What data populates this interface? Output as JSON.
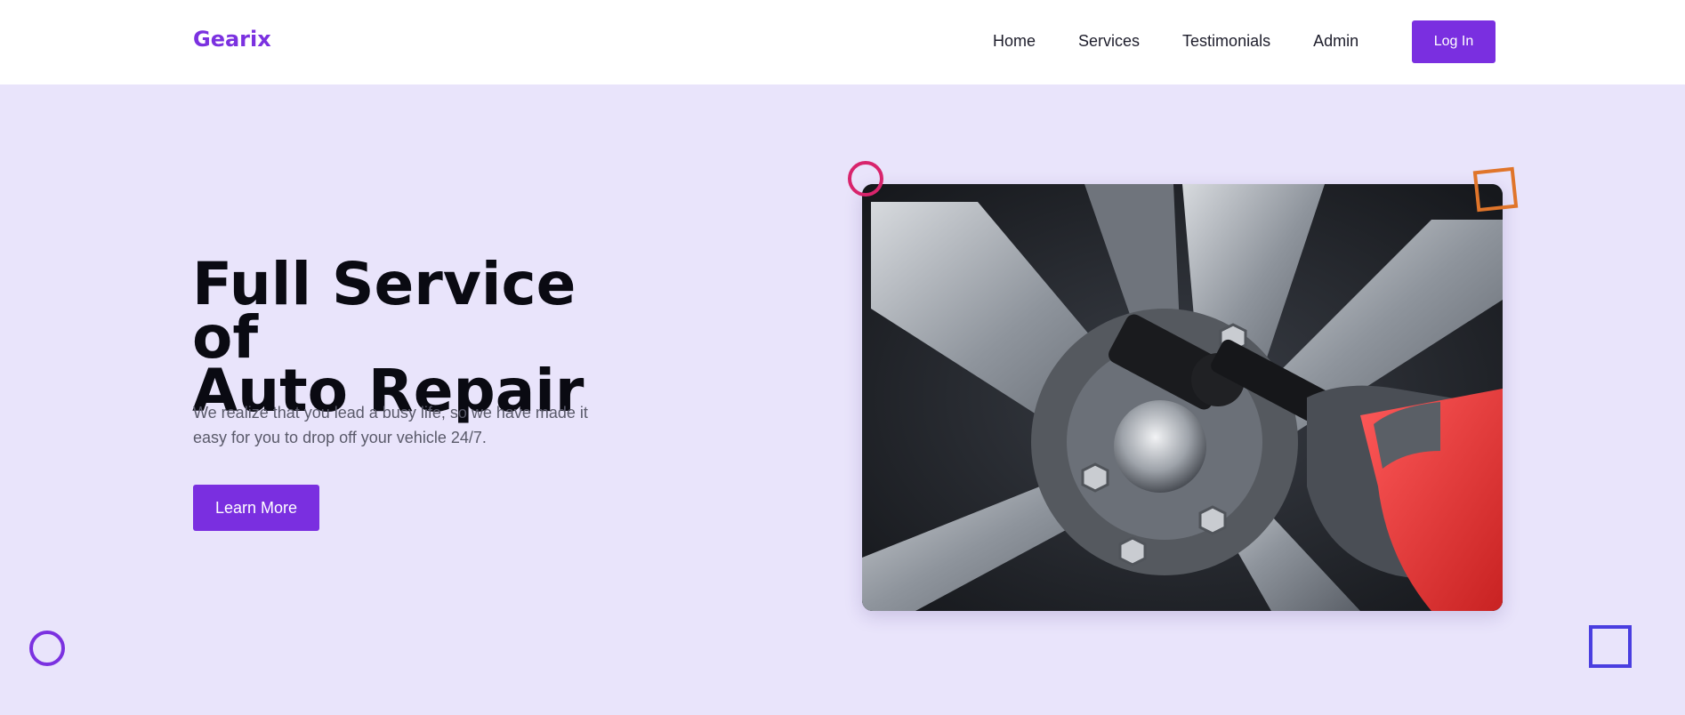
{
  "brand": {
    "name": "Gearix"
  },
  "nav": {
    "links": [
      "Home",
      "Services",
      "Testimonials",
      "Admin"
    ],
    "login_label": "Log In"
  },
  "hero": {
    "title_line1": "Full Service of",
    "title_line2": "Auto Repair",
    "description": "We realize that you lead a busy life, so we have made it easy for you to drop off your vehicle 24/7.",
    "cta_label": "Learn More",
    "image_subject": "impact-wrench-on-car-wheel"
  },
  "colors": {
    "accent": "#7b31e0",
    "background": "#e9e4fb",
    "deco_pink": "#d8246c",
    "deco_orange": "#e0752a",
    "deco_blue": "#4a3ee0",
    "tool_red": "#e83a3a"
  }
}
